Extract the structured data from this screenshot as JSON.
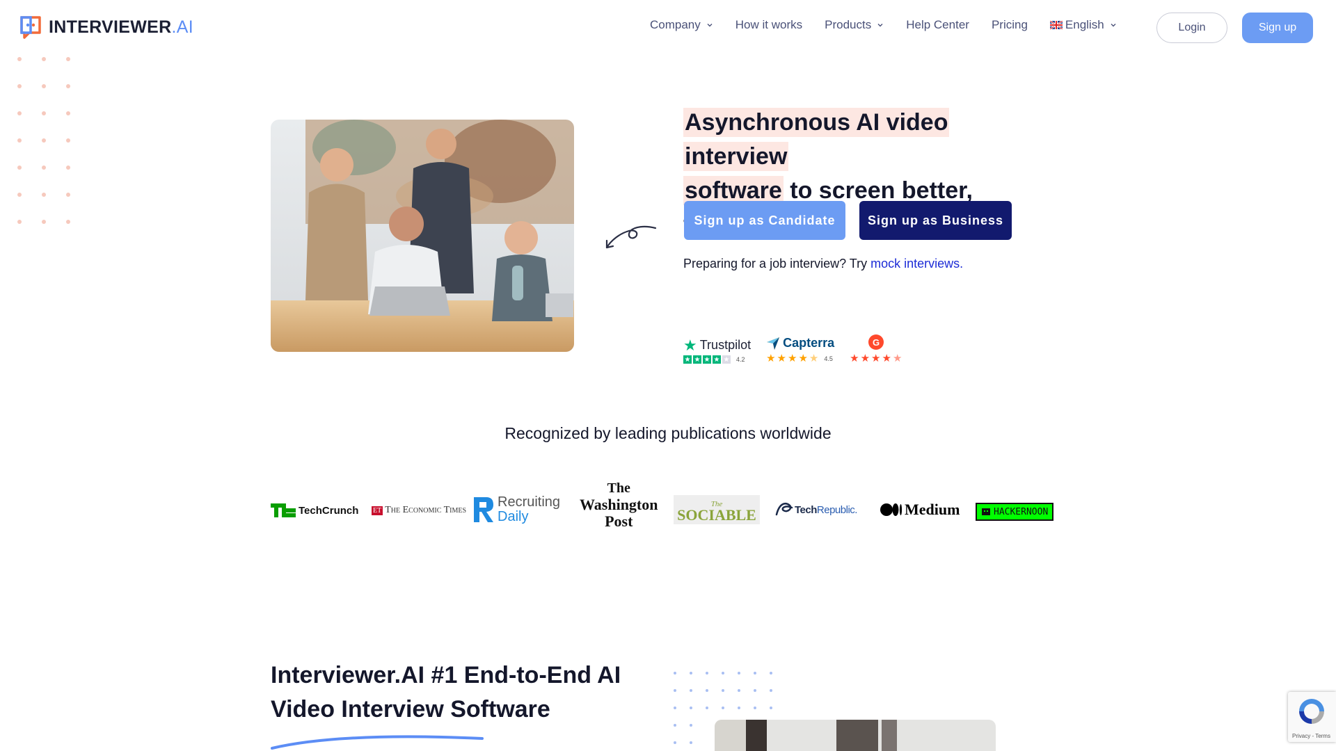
{
  "brand": {
    "name_main": "INTERVIEWER",
    "name_suffix": ".AI"
  },
  "nav": {
    "items": [
      {
        "label": "Company",
        "dropdown": true
      },
      {
        "label": "How it works",
        "dropdown": false
      },
      {
        "label": "Products",
        "dropdown": true
      },
      {
        "label": "Help Center",
        "dropdown": false
      },
      {
        "label": "Pricing",
        "dropdown": false
      },
      {
        "label": "English",
        "dropdown": true
      }
    ],
    "login": "Login",
    "signup": "Sign up"
  },
  "hero": {
    "headline_highlight_1": "Asynchronous AI video interview",
    "headline_highlight_2": "software",
    "headline_rest": " to screen better, faster.",
    "cta_candidate": "Sign up as Candidate",
    "cta_business": "Sign up as Business",
    "mock_prefix": "Preparing for a job interview? Try ",
    "mock_link": "mock interviews."
  },
  "ratings": [
    {
      "name": "Trustpilot",
      "score": "4.2",
      "stars": 4
    },
    {
      "name": "Capterra",
      "score": "4.5",
      "stars": 4.5
    },
    {
      "name": "G2",
      "score": "",
      "stars": 4.5
    }
  ],
  "publications": {
    "heading": "Recognized by leading publications worldwide",
    "logos": [
      {
        "name": "TechCrunch",
        "mark": "TC"
      },
      {
        "name": "The Economic Times",
        "mark": "ET"
      },
      {
        "name": "Recruiting Daily",
        "line1": "Recruiting",
        "line2": "Daily",
        "mark": "R"
      },
      {
        "name": "The Washington Post",
        "line1": "The",
        "line2": "Washington",
        "line3": "Post"
      },
      {
        "name": "The Sociable",
        "line1": "The",
        "line2": "SOCIABLE"
      },
      {
        "name": "TechRepublic",
        "part1": "Tech",
        "part2": "Republic."
      },
      {
        "name": "Medium"
      },
      {
        "name": "HACKERNOON"
      }
    ]
  },
  "section2": {
    "title": "Interviewer.AI #1 End-to-End AI Video Interview Software"
  },
  "recaptcha": {
    "links": "Privacy - Terms"
  },
  "colors": {
    "accent": "#6c9cf3",
    "navy": "#121a6e",
    "highlight": "#fde7e2",
    "dots_salmon": "#f6c9bd",
    "dots_blue": "#a9bff2",
    "logo_orange": "#f26b3a",
    "link": "#1d2cd6"
  }
}
